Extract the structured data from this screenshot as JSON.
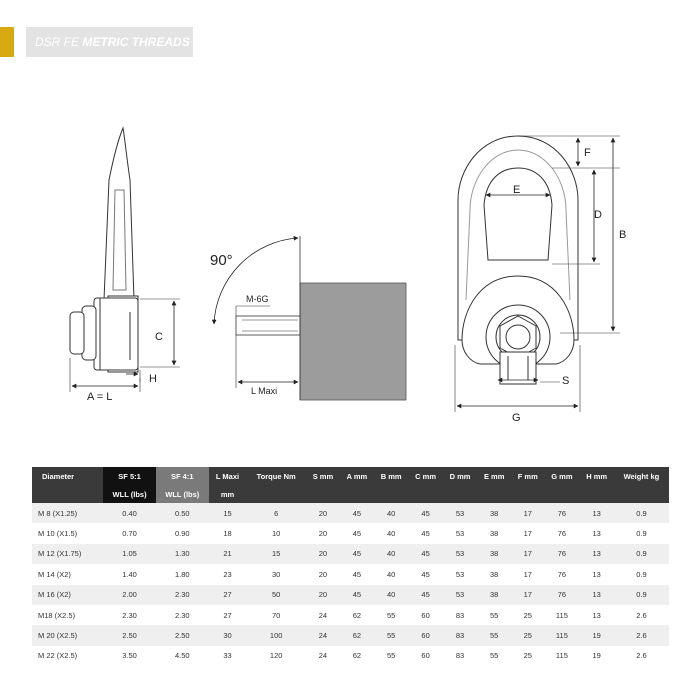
{
  "header": {
    "prefix": "DSR FE",
    "title": "METRIC THREADS"
  },
  "diagram": {
    "labels": {
      "c": "C",
      "h": "H",
      "a_eq_l": "A  =  L",
      "angle": "90°",
      "thread": "M-6G",
      "l_maxi": "L Maxi",
      "f": "F",
      "e": "E",
      "d": "D",
      "b": "B",
      "s": "S",
      "g": "G"
    }
  },
  "table": {
    "headers_top": [
      "Diameter",
      "SF 5:1",
      "SF 4:1",
      "L Maxi",
      "Torque Nm",
      "S mm",
      "A mm",
      "B mm",
      "C mm",
      "D mm",
      "E mm",
      "F mm",
      "G mm",
      "H mm",
      "Weight kg"
    ],
    "headers_sub": [
      "",
      "WLL (lbs)",
      "WLL (lbs)",
      "mm",
      "",
      "",
      "",
      "",
      "",
      "",
      "",
      "",
      "",
      "",
      ""
    ],
    "rows": [
      [
        "M 8 (X1.25)",
        "0.40",
        "0.50",
        "15",
        "6",
        "20",
        "45",
        "40",
        "45",
        "53",
        "38",
        "17",
        "76",
        "13",
        "0.9"
      ],
      [
        "M 10 (X1.5)",
        "0.70",
        "0.90",
        "18",
        "10",
        "20",
        "45",
        "40",
        "45",
        "53",
        "38",
        "17",
        "76",
        "13",
        "0.9"
      ],
      [
        "M 12 (X1.75)",
        "1.05",
        "1.30",
        "21",
        "15",
        "20",
        "45",
        "40",
        "45",
        "53",
        "38",
        "17",
        "76",
        "13",
        "0.9"
      ],
      [
        "M 14 (X2)",
        "1.40",
        "1.80",
        "23",
        "30",
        "20",
        "45",
        "40",
        "45",
        "53",
        "38",
        "17",
        "76",
        "13",
        "0.9"
      ],
      [
        "M 16 (X2)",
        "2.00",
        "2.30",
        "27",
        "50",
        "20",
        "45",
        "40",
        "45",
        "53",
        "38",
        "17",
        "76",
        "13",
        "0.9"
      ],
      [
        "M18 (X2.5)",
        "2.30",
        "2.30",
        "27",
        "70",
        "24",
        "62",
        "55",
        "60",
        "83",
        "55",
        "25",
        "115",
        "13",
        "2.6"
      ],
      [
        "M 20 (X2.5)",
        "2.50",
        "2.50",
        "30",
        "100",
        "24",
        "62",
        "55",
        "60",
        "83",
        "55",
        "25",
        "115",
        "19",
        "2.6"
      ],
      [
        "M 22 (X2.5)",
        "3.50",
        "4.50",
        "33",
        "120",
        "24",
        "62",
        "55",
        "60",
        "83",
        "55",
        "25",
        "115",
        "19",
        "2.6"
      ]
    ]
  }
}
